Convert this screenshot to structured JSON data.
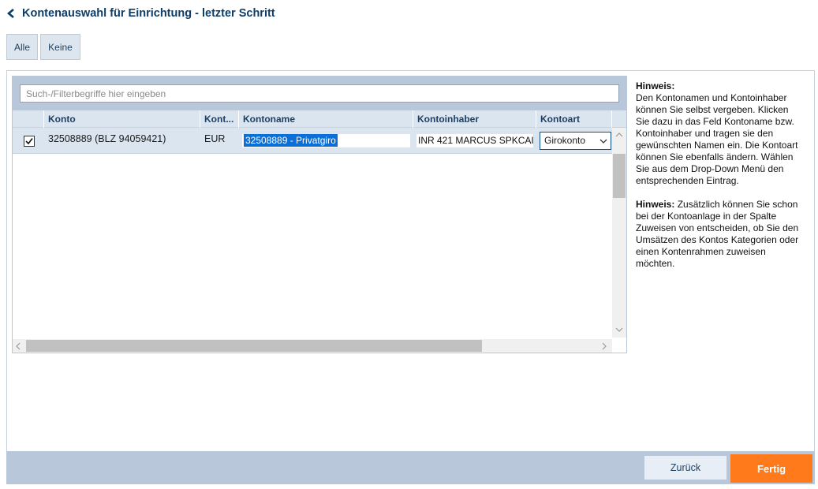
{
  "header": {
    "title": "Kontenauswahl für Einrichtung - letzter Schritt"
  },
  "selection": {
    "all_label": "Alle",
    "none_label": "Keine"
  },
  "search": {
    "placeholder": "Such-/Filterbegriffe hier eingeben",
    "value": ""
  },
  "table": {
    "columns": [
      "Konto",
      "Kont...",
      "Kontoname",
      "Kontoinhaber",
      "Kontoart"
    ],
    "rows": [
      {
        "checked": true,
        "konto": "32508889 (BLZ 94059421)",
        "waehrung": "EUR",
        "kontoname": "32508889 - Privatgiro",
        "kontoinhaber": "INR 421 MARCUS SPKCAI",
        "kontoart": "Girokonto"
      }
    ]
  },
  "hints": {
    "label1": "Hinweis:",
    "text1": "Den Kontonamen und Kontoinhaber können Sie selbst vergeben. Klicken Sie dazu in das Feld Kontoname bzw. Kontoinhaber und tragen sie den gewünschten Namen ein. Die Kontoart können Sie ebenfalls ändern. Wählen Sie aus dem Drop-Down Menü den entsprechenden Eintrag.",
    "label2": "Hinweis:",
    "text2": "Zusätzlich können Sie schon bei der Kontoanlage in der Spalte Zuweisen von entscheiden, ob Sie den Umsätzen des Kontos Kategorien oder einen Kontenrahmen zuweisen möchten."
  },
  "footer": {
    "back_label": "Zurück",
    "finish_label": "Fertig"
  },
  "colors": {
    "accent": "#ff7a1a",
    "title": "#0d3c66",
    "bar": "#b8c7d9"
  }
}
